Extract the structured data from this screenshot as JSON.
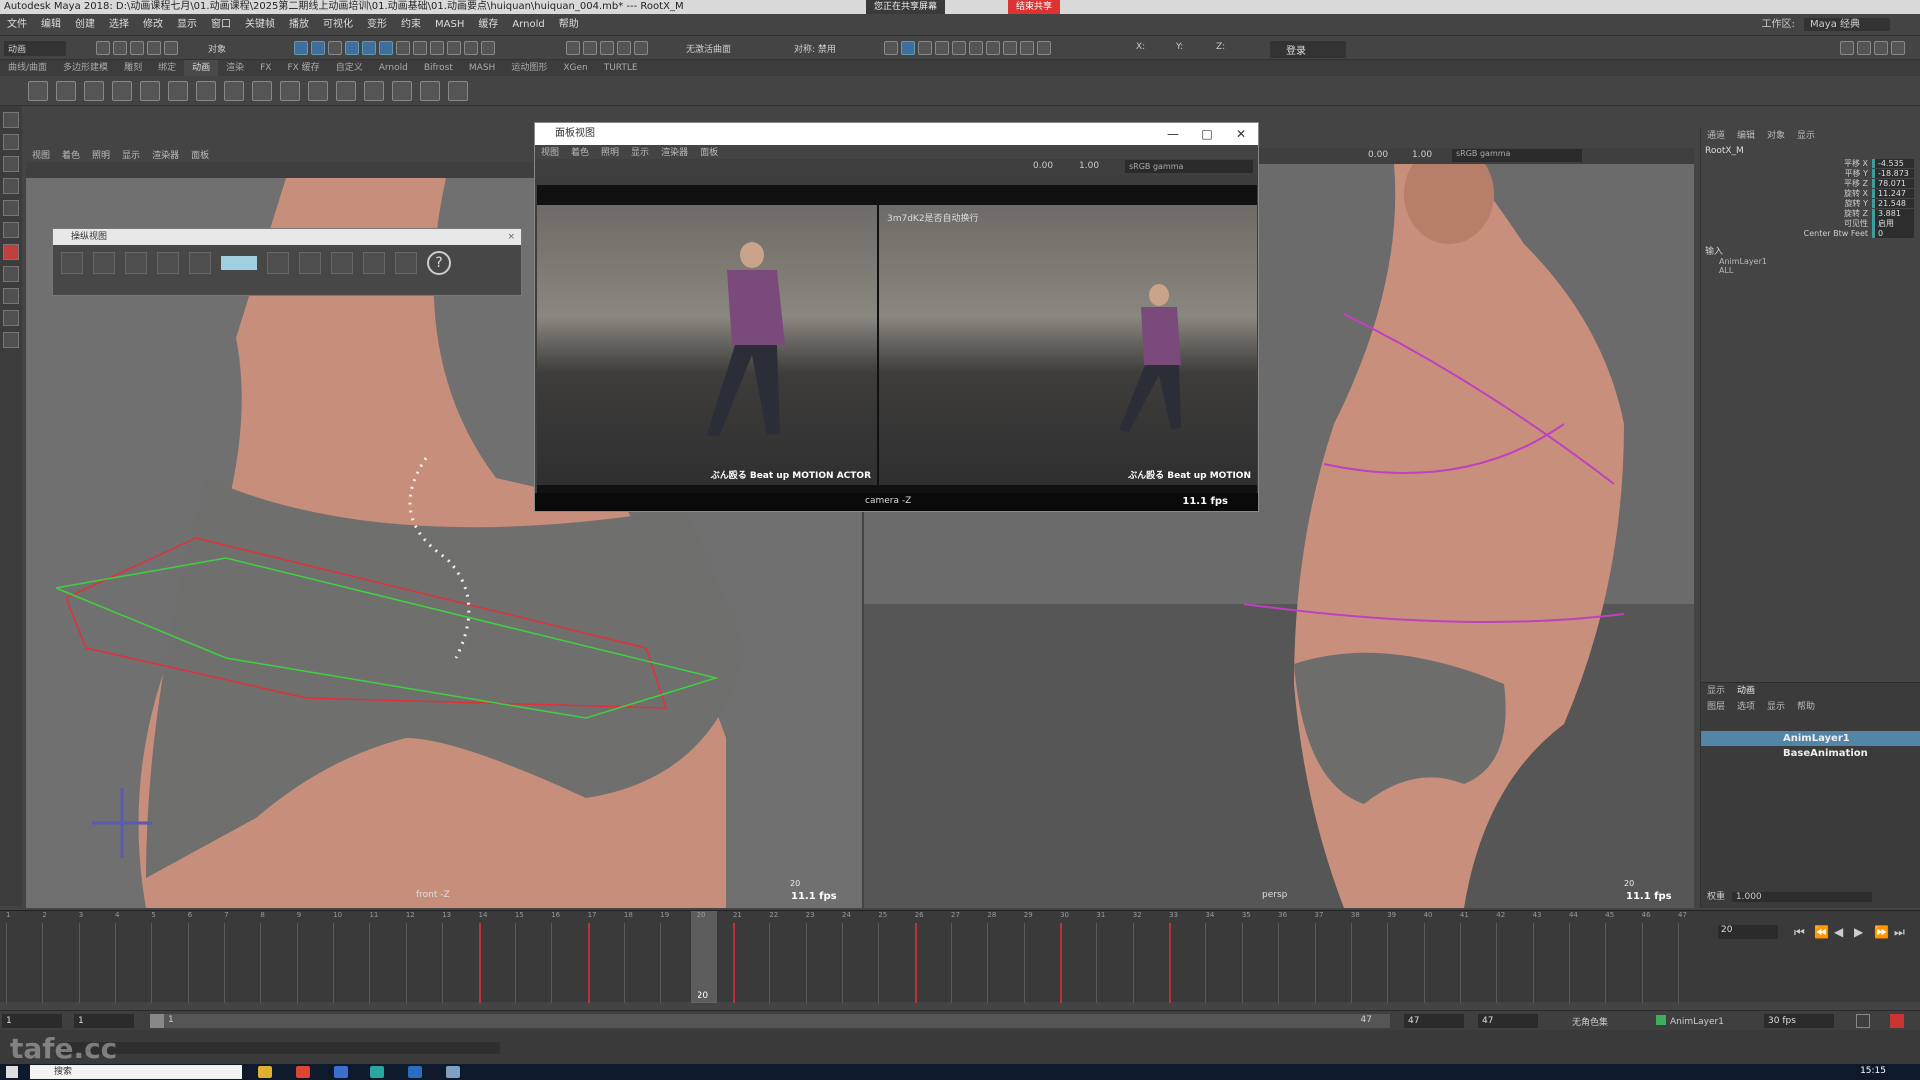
{
  "window": {
    "title": "Autodesk Maya 2018: D:\\动画课程七月\\01.动画课程\\2025第二期线上动画培训\\01.动画基础\\01.动画要点\\huiquan\\huiquan_004.mb* --- RootX_M",
    "share_status": "您正在共享屏幕",
    "share_stop": "结束共享"
  },
  "menubar": {
    "items": [
      "文件",
      "编辑",
      "创建",
      "选择",
      "修改",
      "显示",
      "窗口",
      "关键帧",
      "播放",
      "可视化",
      "变形",
      "约束",
      "MASH",
      "缓存",
      "Arnold",
      "帮助"
    ],
    "workspace_label": "工作区:",
    "workspace_value": "Maya 经典"
  },
  "statusline": {
    "menuset": "动画",
    "object_mode": "对象",
    "no_live_surface": "无激活曲面",
    "symmetry": "对称: 禁用",
    "login": "登录",
    "x_label": "X:",
    "y_label": "Y:",
    "z_label": "Z:"
  },
  "shelf": {
    "tabs": [
      "曲线/曲面",
      "多边形建模",
      "雕刻",
      "绑定",
      "动画",
      "渲染",
      "FX",
      "FX 缓存",
      "自定义",
      "Arnold",
      "Bifrost",
      "MASH",
      "运动图形",
      "XGen",
      "TURTLE"
    ],
    "active_tab": "动画"
  },
  "viewport_left": {
    "menu": [
      "视图",
      "着色",
      "照明",
      "显示",
      "渲染器",
      "面板"
    ],
    "camera": "front -Z",
    "frame": "20",
    "fps": "11.1 fps"
  },
  "viewport_right": {
    "exposure": "0.00",
    "gamma": "1.00",
    "colorspace": "sRGB gamma",
    "camera": "persp",
    "frame": "20",
    "fps": "11.1 fps"
  },
  "tool_window": {
    "title": "操纵视图",
    "help_glyph": "?"
  },
  "video_window": {
    "title": "面板视图",
    "menu": [
      "视图",
      "着色",
      "照明",
      "显示",
      "渲染器",
      "面板"
    ],
    "exposure": "0.00",
    "gamma": "1.00",
    "colorspace": "sRGB gamma",
    "caption_left": "ぶん殴る Beat up MOTION ACTOR",
    "caption_right": "ぶん殴る Beat up MOTION",
    "overlay_mid": "3m7dK2是否自动换行",
    "camera": "camera -Z",
    "fps": "11.1 fps",
    "minimize": "—",
    "maximize": "□",
    "close": "✕"
  },
  "channel_box": {
    "tabs": [
      "通道",
      "编辑",
      "对象",
      "显示"
    ],
    "object": "RootX_M",
    "attributes": [
      {
        "label": "平移 X",
        "value": "-4.535"
      },
      {
        "label": "平移 Y",
        "value": "-18.873"
      },
      {
        "label": "平移 Z",
        "value": "78.071"
      },
      {
        "label": "旋转 X",
        "value": "11.247"
      },
      {
        "label": "旋转 Y",
        "value": "21.548"
      },
      {
        "label": "旋转 Z",
        "value": "3.881"
      },
      {
        "label": "可见性",
        "value": "启用"
      },
      {
        "label": "Center Btw Feet",
        "value": "0"
      }
    ],
    "inputs_header": "输入",
    "inputs": [
      "AnimLayer1",
      "ALL"
    ]
  },
  "layer_editor": {
    "tabs": [
      "显示",
      "动画"
    ],
    "menu": [
      "图层",
      "选项",
      "显示",
      "帮助"
    ],
    "layers": [
      {
        "name": "AnimLayer1",
        "selected": true
      },
      {
        "name": "BaseAnimation",
        "selected": false
      }
    ],
    "weight_label": "权重",
    "weight_value": "1.000"
  },
  "timeline": {
    "start": 1,
    "end": 47,
    "current_frame": 20,
    "tick_labels": [
      "1",
      "2",
      "3",
      "4",
      "5",
      "6",
      "7",
      "8",
      "9",
      "10",
      "11",
      "12",
      "13",
      "14",
      "15",
      "16",
      "17",
      "18",
      "19",
      "20",
      "21",
      "22",
      "23",
      "24",
      "25",
      "26",
      "27",
      "28",
      "29",
      "30",
      "31",
      "32",
      "33",
      "34",
      "35",
      "36",
      "37",
      "38",
      "39",
      "40",
      "41",
      "42",
      "43",
      "44",
      "45",
      "46",
      "47"
    ],
    "key_frames": [
      14,
      17,
      21,
      26,
      30,
      33
    ],
    "current_frame_label": "20"
  },
  "range": {
    "start": "1",
    "start_inner": "1",
    "slider_label": "1",
    "end_inner": "47",
    "end": "47",
    "end_outer": "47",
    "no_char_set": "无角色集",
    "anim_layer": "AnimLayer1",
    "fps": "30 fps"
  },
  "playback": {
    "current": "20",
    "buttons": [
      "⏮",
      "⏪",
      "◀",
      "▶",
      "⏩",
      "⏭"
    ]
  },
  "footer": {
    "watermark": "tafe.cc"
  },
  "taskbar": {
    "search": "搜索",
    "clock": "15:15"
  }
}
